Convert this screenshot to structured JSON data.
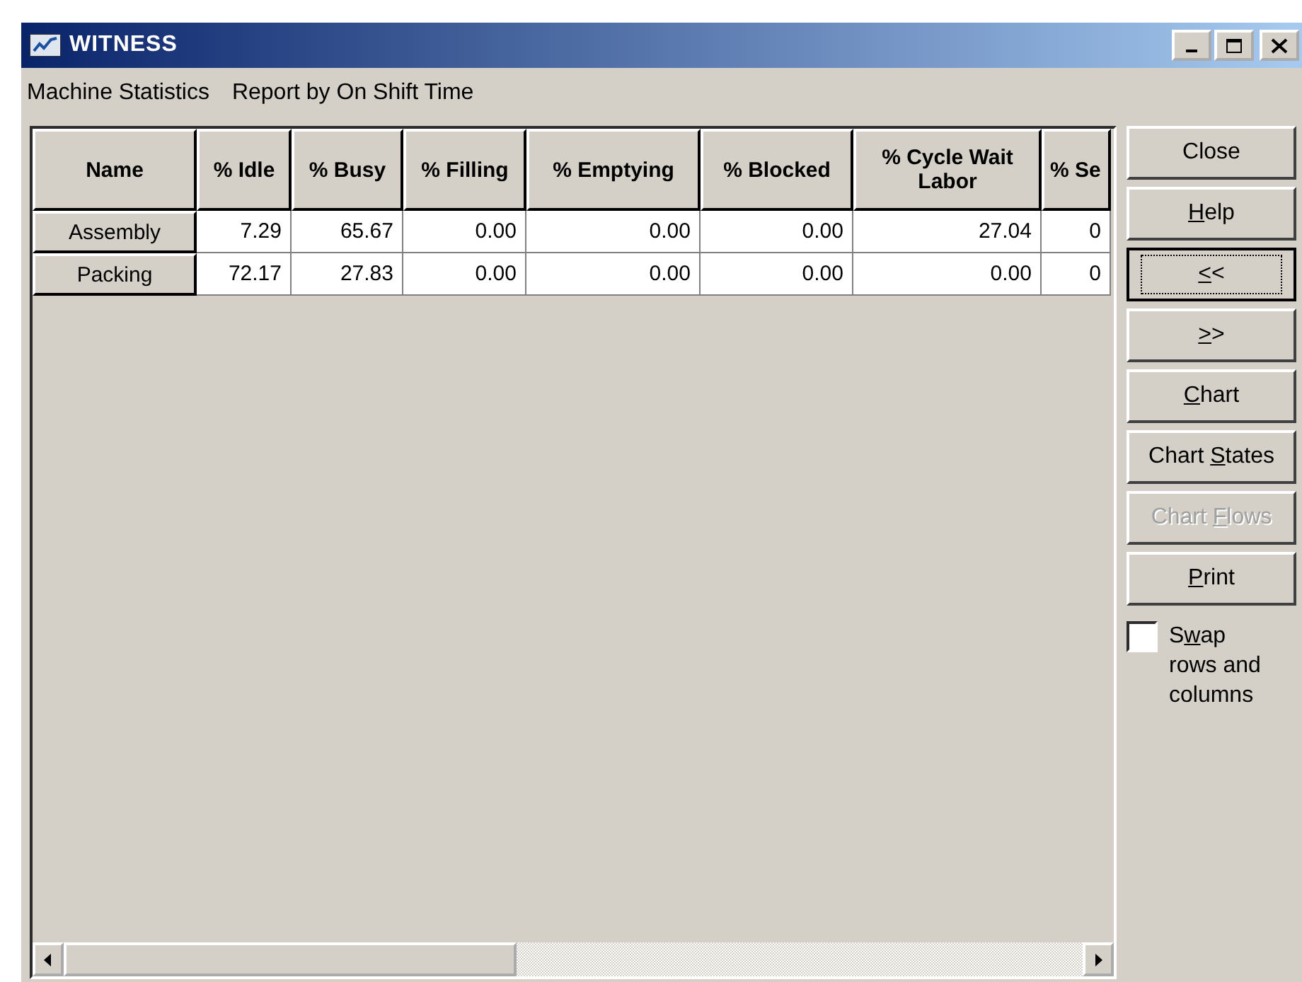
{
  "window": {
    "title": "WITNESS"
  },
  "report": {
    "title": "Machine Statistics",
    "subtitle": "Report by On Shift Time"
  },
  "table": {
    "columns": [
      "Name",
      "% Idle",
      "% Busy",
      "% Filling",
      "% Emptying",
      "% Blocked",
      "% Cycle Wait Labor",
      "% Se"
    ],
    "rows": [
      {
        "cells": [
          "Assembly",
          "7.29",
          "65.67",
          "0.00",
          "0.00",
          "0.00",
          "27.04",
          "0"
        ]
      },
      {
        "cells": [
          "Packing",
          "72.17",
          "27.83",
          "0.00",
          "0.00",
          "0.00",
          "0.00",
          "0"
        ]
      }
    ]
  },
  "buttons": [
    {
      "before": "Close",
      "disabled": false,
      "focused": false
    },
    {
      "key": "H",
      "after": "elp",
      "disabled": false,
      "focused": false
    },
    {
      "key": "<",
      "after": "<",
      "disabled": false,
      "focused": true
    },
    {
      "key": ">",
      "after": ">",
      "disabled": false,
      "focused": false
    },
    {
      "key": "C",
      "after": "hart",
      "disabled": false,
      "focused": false
    },
    {
      "before": "Chart ",
      "key": "S",
      "after": "tates",
      "disabled": false,
      "focused": false
    },
    {
      "before": "Chart ",
      "key": "F",
      "after": "lows",
      "disabled": true,
      "focused": false
    },
    {
      "key": "P",
      "after": "rint",
      "disabled": false,
      "focused": false
    }
  ],
  "swap": {
    "before": "S",
    "key": "w",
    "after": "ap rows and columns",
    "checked": false
  }
}
